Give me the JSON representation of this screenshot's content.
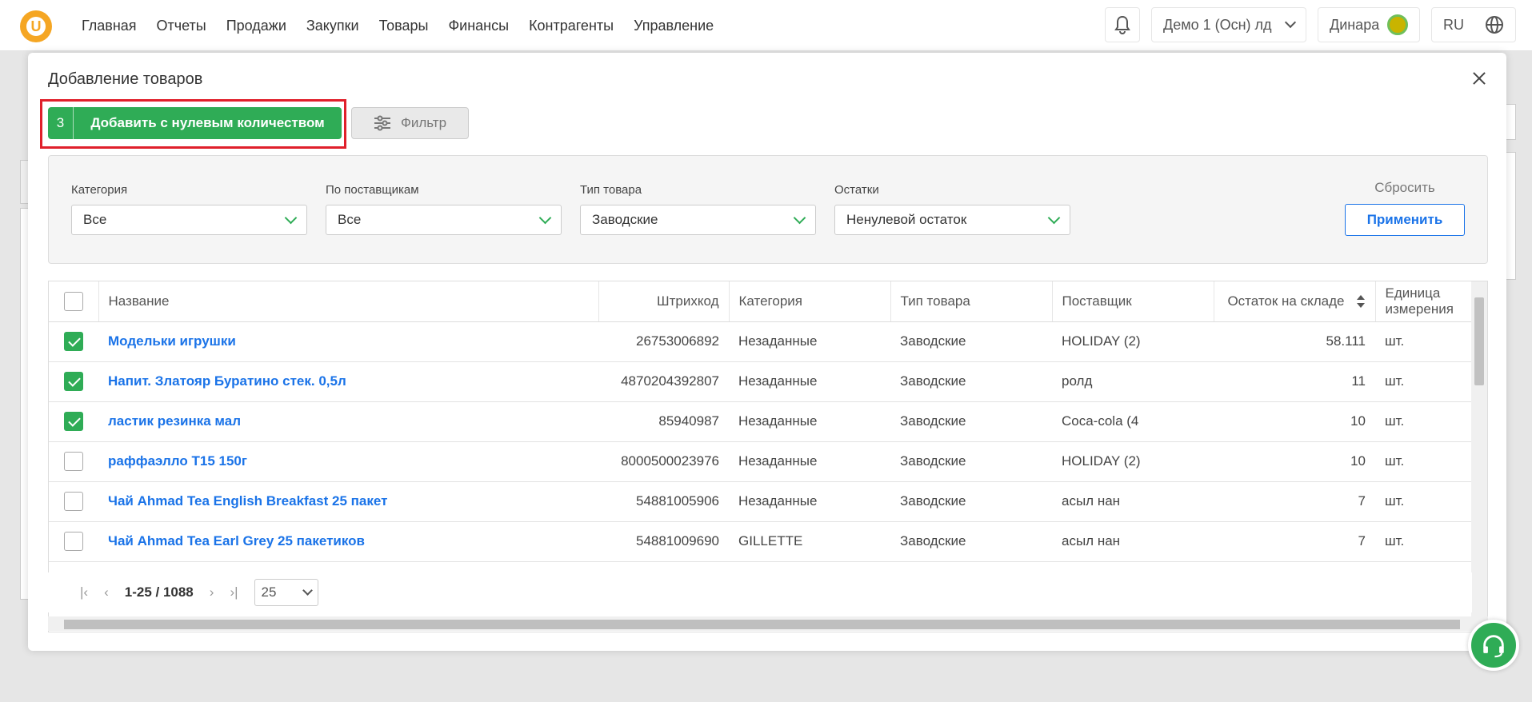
{
  "nav": [
    "Главная",
    "Отчеты",
    "Продажи",
    "Закупки",
    "Товары",
    "Финансы",
    "Контрагенты",
    "Управление"
  ],
  "header": {
    "store": "Демо 1 (Осн) лд",
    "user": "Динара",
    "lang": "RU"
  },
  "modal": {
    "title": "Добавление товаров",
    "add_count": "3",
    "add_label": "Добавить с нулевым количеством",
    "filter_label": "Фильтр"
  },
  "filters": [
    {
      "label": "Категория",
      "value": "Все"
    },
    {
      "label": "По поставщикам",
      "value": "Все"
    },
    {
      "label": "Тип товара",
      "value": "Заводские"
    },
    {
      "label": "Остатки",
      "value": "Ненулевой остаток"
    }
  ],
  "reset_label": "Сбросить",
  "apply_label": "Применить",
  "columns": [
    "Название",
    "Штрихкод",
    "Категория",
    "Тип товара",
    "Поставщик",
    "Остаток на складе",
    "Единица измерения"
  ],
  "rows": [
    {
      "checked": true,
      "name": "Модельки игрушки",
      "barcode": "26753006892",
      "category": "Незаданные",
      "type": "Заводские",
      "supplier": "HOLIDAY (2)",
      "stock": "58.111",
      "unit": "шт."
    },
    {
      "checked": true,
      "name": "Напит. Златояр Буратино стек. 0,5л",
      "barcode": "4870204392807",
      "category": "Незаданные",
      "type": "Заводские",
      "supplier": "ролд",
      "stock": "11",
      "unit": "шт."
    },
    {
      "checked": true,
      "name": "ластик резинка мал",
      "barcode": "85940987",
      "category": "Незаданные",
      "type": "Заводские",
      "supplier": "Coca-cola (4",
      "stock": "10",
      "unit": "шт."
    },
    {
      "checked": false,
      "name": "раффаэлло Т15 150г",
      "barcode": "8000500023976",
      "category": "Незаданные",
      "type": "Заводские",
      "supplier": "HOLIDAY (2)",
      "stock": "10",
      "unit": "шт."
    },
    {
      "checked": false,
      "name": "Чай Ahmad Tea English Breakfast 25 пакет",
      "barcode": "54881005906",
      "category": "Незаданные",
      "type": "Заводские",
      "supplier": "асыл нан",
      "stock": "7",
      "unit": "шт."
    },
    {
      "checked": false,
      "name": "Чай Ahmad Tea Earl Grey 25 пакетиков",
      "barcode": "54881009690",
      "category": "GILLETTE",
      "type": "Заводские",
      "supplier": "асыл нан",
      "stock": "7",
      "unit": "шт."
    }
  ],
  "pager": {
    "range": "1-25 / 1088",
    "page_size": "25"
  }
}
